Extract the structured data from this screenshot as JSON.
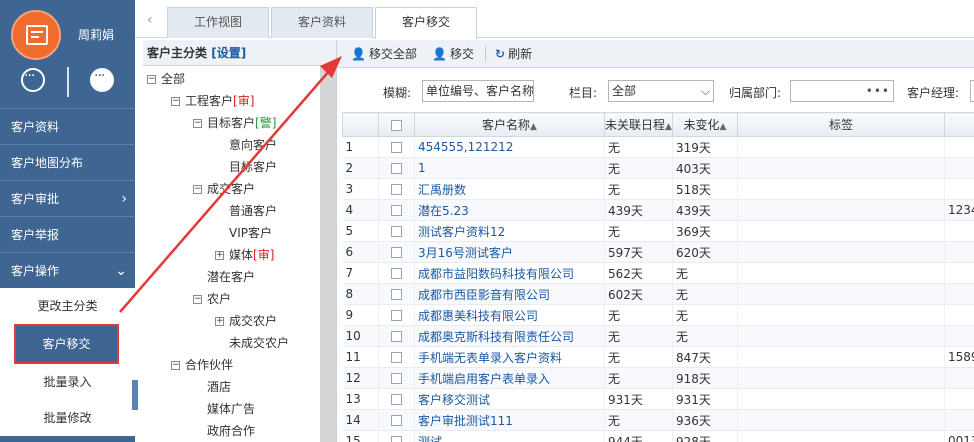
{
  "user": {
    "name": "周莉娟"
  },
  "sidebar": {
    "items": [
      {
        "label": "客户资料"
      },
      {
        "label": "客户地图分布"
      },
      {
        "label": "客户审批",
        "chevron": "chevron-right-icon"
      },
      {
        "label": "客户举报"
      },
      {
        "label": "客户操作",
        "chevron": "chevron-down-icon"
      }
    ],
    "sub_items": [
      {
        "label": "更改主分类"
      },
      {
        "label": "客户移交",
        "active": true
      },
      {
        "label": "批量录入"
      },
      {
        "label": "批量修改"
      }
    ]
  },
  "tabs": [
    {
      "label": "工作视图"
    },
    {
      "label": "客户资料"
    },
    {
      "label": "客户移交",
      "active": true
    }
  ],
  "tree": {
    "header": "客户主分类",
    "settings_link": "[设置]",
    "nodes": [
      {
        "label": "全部",
        "expander": "⊟",
        "tag": ""
      },
      {
        "label": "工程客户",
        "expander": "⊟",
        "tag": "[审]"
      },
      {
        "label": "目标客户",
        "expander": "⊟",
        "tag": "[警]"
      },
      {
        "label": "意向客户",
        "expander": "",
        "tag": ""
      },
      {
        "label": "目标客户",
        "expander": "",
        "tag": ""
      },
      {
        "label": "成交客户",
        "expander": "⊟",
        "tag": ""
      },
      {
        "label": "普通客户",
        "expander": "",
        "tag": ""
      },
      {
        "label": "VIP客户",
        "expander": "",
        "tag": ""
      },
      {
        "label": "媒体",
        "expander": "⊞",
        "tag": "[审]"
      },
      {
        "label": "潜在客户",
        "expander": "",
        "tag": ""
      },
      {
        "label": "农户",
        "expander": "⊟",
        "tag": ""
      },
      {
        "label": "成交农户",
        "expander": "⊞",
        "tag": ""
      },
      {
        "label": "未成交农户",
        "expander": "",
        "tag": ""
      },
      {
        "label": "合作伙伴",
        "expander": "⊟",
        "tag": ""
      },
      {
        "label": "酒店",
        "expander": "",
        "tag": ""
      },
      {
        "label": "媒体广告",
        "expander": "",
        "tag": ""
      },
      {
        "label": "政府合作",
        "expander": "",
        "tag": ""
      }
    ]
  },
  "toolbar": {
    "transfer_all": "移交全部",
    "transfer": "移交",
    "refresh": "刷新"
  },
  "filter": {
    "fuzzy_label": "模糊:",
    "fuzzy_value": "单位编号、客户名称",
    "column_label": "栏目:",
    "column_value": "全部",
    "dept_label": "归属部门:",
    "dept_value": "",
    "manager_label": "客户经理:"
  },
  "table": {
    "columns": [
      "",
      "",
      "客户名称",
      "未关联日程",
      "未变化",
      "标签",
      ""
    ],
    "rows": [
      {
        "n": "1",
        "name": "454555,121212",
        "unlinked": "无",
        "unchanged": "319天",
        "tag": "",
        "extra": ""
      },
      {
        "n": "2",
        "name": "1",
        "unlinked": "无",
        "unchanged": "403天",
        "tag": "",
        "extra": ""
      },
      {
        "n": "3",
        "name": "汇禹册数",
        "unlinked": "无",
        "unchanged": "518天",
        "tag": "",
        "extra": ""
      },
      {
        "n": "4",
        "name": "潜在5.23",
        "unlinked": "439天",
        "unchanged": "439天",
        "tag": "",
        "extra": "1234"
      },
      {
        "n": "5",
        "name": "测试客户资料12",
        "unlinked": "无",
        "unchanged": "369天",
        "tag": "",
        "extra": ""
      },
      {
        "n": "6",
        "name": "3月16号测试客户",
        "unlinked": "597天",
        "unchanged": "620天",
        "tag": "",
        "extra": ""
      },
      {
        "n": "7",
        "name": "成都市益阳数码科技有限公司",
        "unlinked": "562天",
        "unchanged": "无",
        "tag": "",
        "extra": ""
      },
      {
        "n": "8",
        "name": "成都市西臣影音有限公司",
        "unlinked": "602天",
        "unchanged": "无",
        "tag": "",
        "extra": ""
      },
      {
        "n": "9",
        "name": "成都惠美科技有限公司",
        "unlinked": "无",
        "unchanged": "无",
        "tag": "",
        "extra": ""
      },
      {
        "n": "10",
        "name": "成都奥克斯科技有限责任公司",
        "unlinked": "无",
        "unchanged": "无",
        "tag": "",
        "extra": ""
      },
      {
        "n": "11",
        "name": "手机端无表单录入客户资料",
        "unlinked": "无",
        "unchanged": "847天",
        "tag": "",
        "extra": "1589"
      },
      {
        "n": "12",
        "name": "手机端启用客户表单录入",
        "unlinked": "无",
        "unchanged": "918天",
        "tag": "",
        "extra": ""
      },
      {
        "n": "13",
        "name": "客户移交测试",
        "unlinked": "931天",
        "unchanged": "931天",
        "tag": "",
        "extra": ""
      },
      {
        "n": "14",
        "name": "客户审批测试111",
        "unlinked": "无",
        "unchanged": "936天",
        "tag": "",
        "extra": ""
      },
      {
        "n": "15",
        "name": "测试",
        "unlinked": "944天",
        "unchanged": "928天",
        "tag": "",
        "extra": "0013"
      }
    ]
  },
  "colors": {
    "sidebar": "#3f6593",
    "accent_red": "#e53935",
    "link": "#1a5aa5"
  }
}
